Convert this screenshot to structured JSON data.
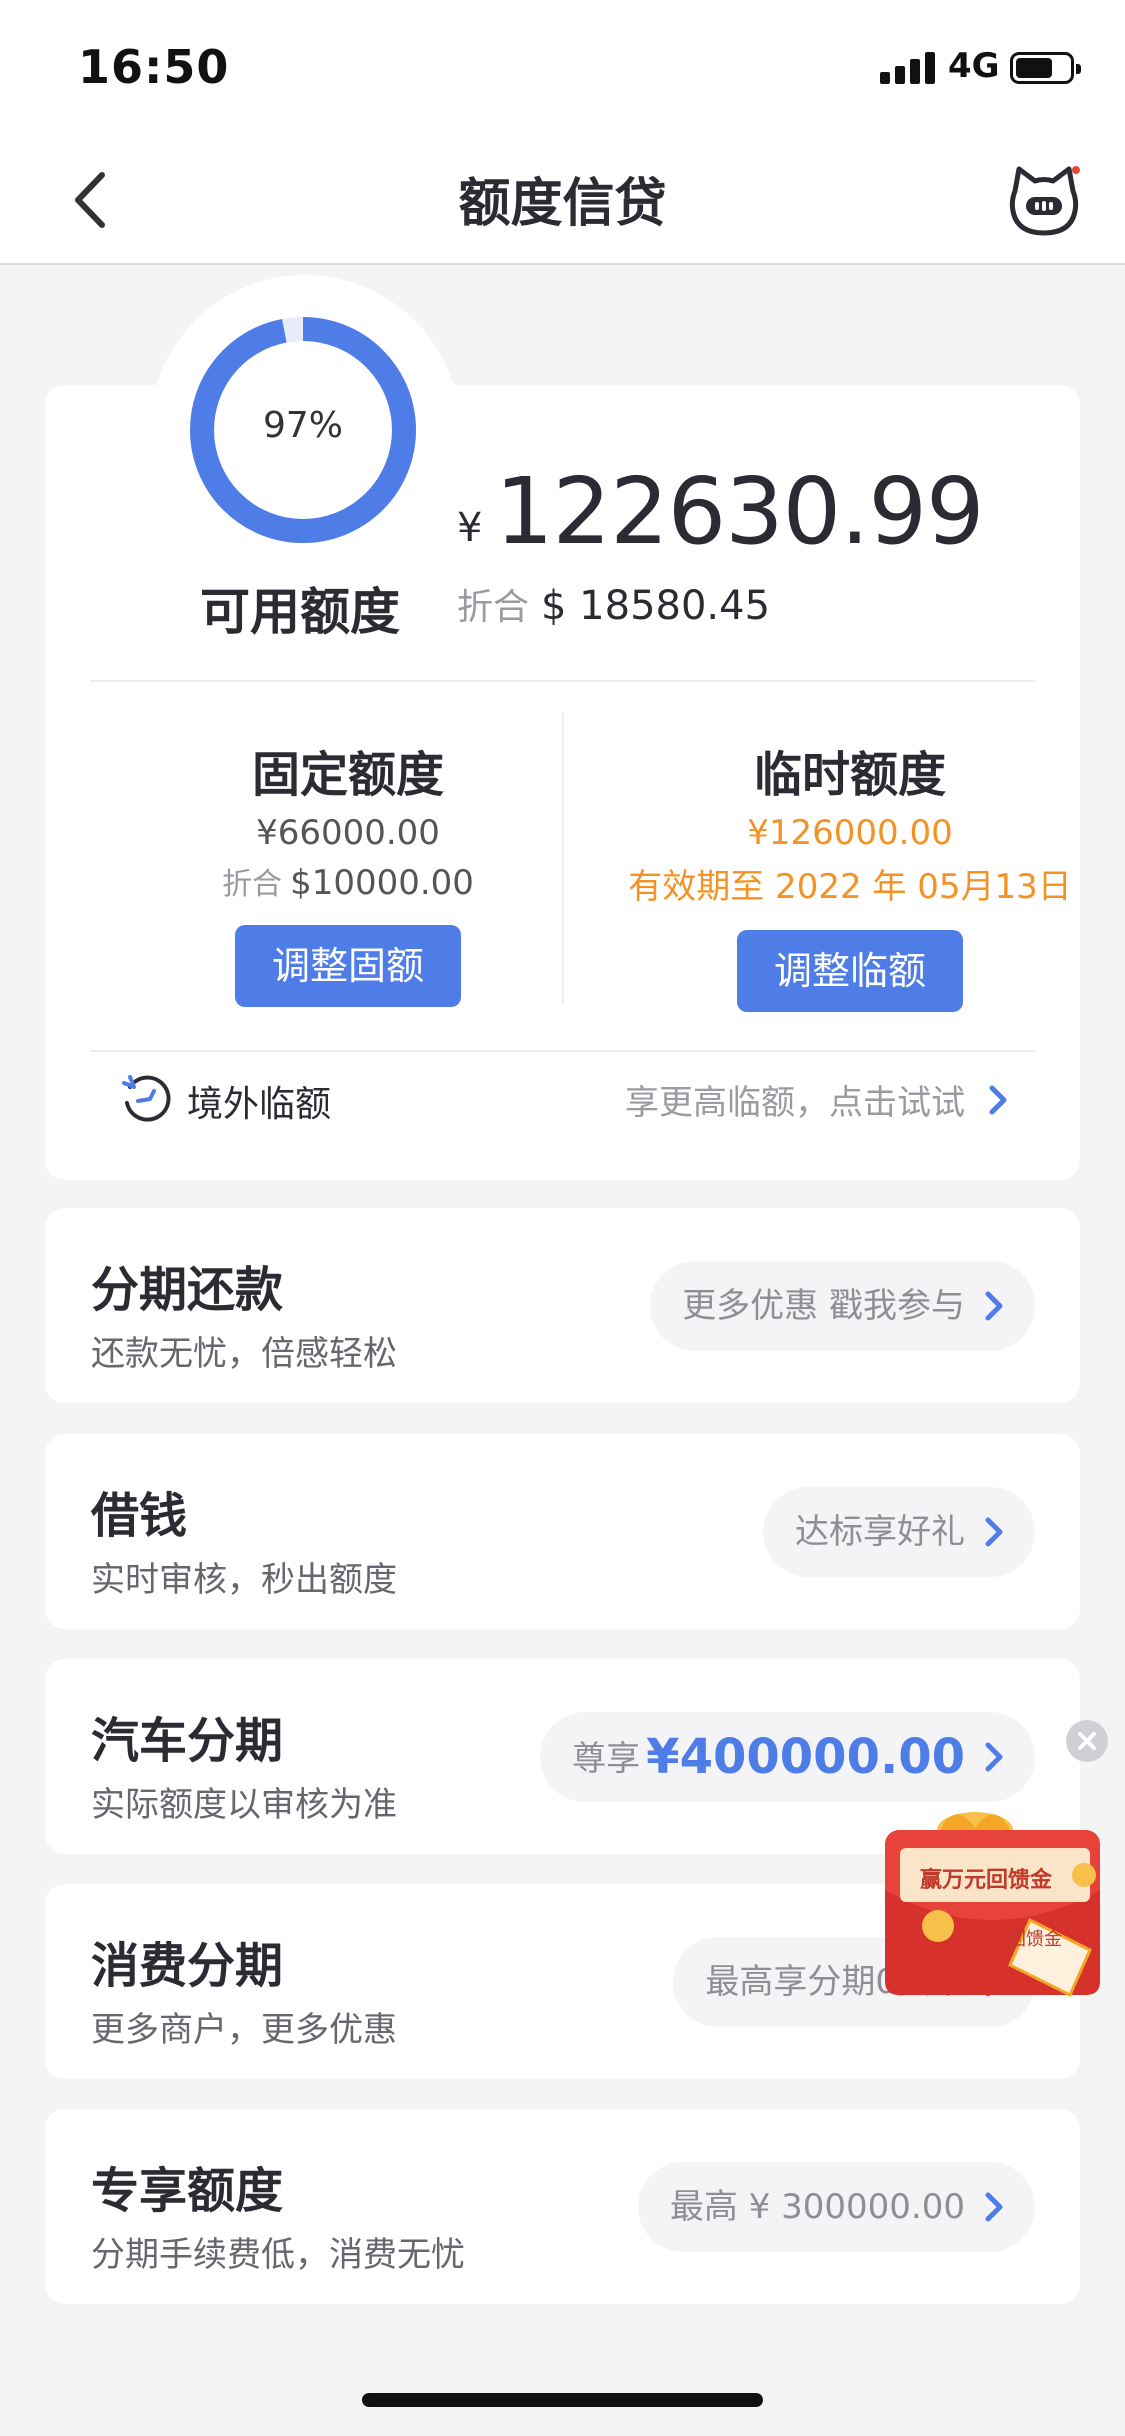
{
  "status_bar": {
    "time": "16:50",
    "network": "4G"
  },
  "nav": {
    "title": "额度信贷"
  },
  "credit": {
    "usage_percent_label": "97%",
    "usage_fraction": 0.97,
    "available_label": "可用额度",
    "currency_symbol": "¥",
    "available_amount": "122630.99",
    "usd_prefix": "折合",
    "usd_amount": "$ 18580.45"
  },
  "fixed_quota": {
    "title": "固定额度",
    "amount": "¥66000.00",
    "usd_prefix": "折合",
    "usd_amount": "$10000.00",
    "button": "调整固额"
  },
  "temp_quota": {
    "title": "临时额度",
    "amount": "¥126000.00",
    "validity": "有效期至 2022 年 05月13日",
    "button": "调整临额"
  },
  "overseas": {
    "label": "境外临额",
    "hint": "享更高临额，点击试试"
  },
  "services": [
    {
      "title": "分期还款",
      "subtitle": "还款无忧，倍感轻松",
      "pill": "更多优惠 戳我参与"
    },
    {
      "title": "借钱",
      "subtitle": "实时审核，秒出额度",
      "pill": "达标享好礼"
    },
    {
      "title": "汽车分期",
      "subtitle": "实际额度以审核为准",
      "pill": "尊享",
      "pill_highlight": "¥400000.00"
    },
    {
      "title": "消费分期",
      "subtitle": "更多商户，更多优惠",
      "pill": "最高享分期0费率"
    },
    {
      "title": "专享额度",
      "subtitle": "分期手续费低，消费无忧",
      "pill": "最高 ¥ 300000.00"
    }
  ],
  "promo": {
    "text": "赢万元回馈金",
    "tag": "回馈金"
  },
  "colors": {
    "accent": "#4f7de8",
    "warning": "#f39325",
    "background": "#f4f4f4"
  }
}
